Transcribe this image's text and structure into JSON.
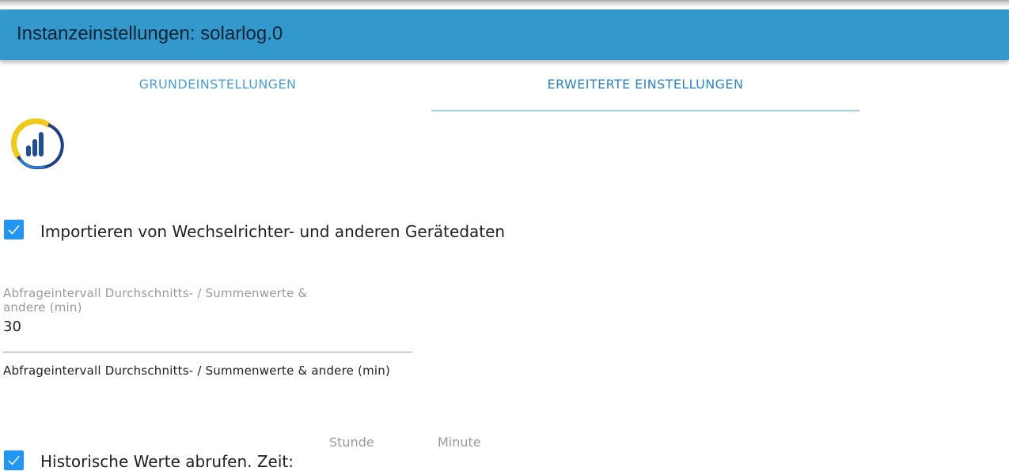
{
  "dialog": {
    "title": "Instanzeinstellungen: solarlog.0"
  },
  "tabs": [
    {
      "label": "GRUNDEINSTELLUNGEN",
      "active": false
    },
    {
      "label": "ERWEITERTE EINSTELLUNGEN",
      "active": true
    }
  ],
  "logo": {
    "icon": "solarlog-logo-icon"
  },
  "import_devices": {
    "checked": true,
    "label": "Importieren von Wechselrichter- und anderen Gerätedaten"
  },
  "poll_interval": {
    "label": "Abfrageintervall Durchschnitts- / Summenwerte & andere (min)",
    "value": "30",
    "helper": "Abfrageintervall Durchschnitts- / Summenwerte & andere (min)"
  },
  "history": {
    "checked": true,
    "label": "Historische Werte abrufen. Zeit:",
    "hour_label": "Stunde",
    "minute_label": "Minute"
  },
  "colors": {
    "accent": "#3399cc",
    "checkbox": "#2196f3",
    "tab_text": "#4a9fdd"
  }
}
